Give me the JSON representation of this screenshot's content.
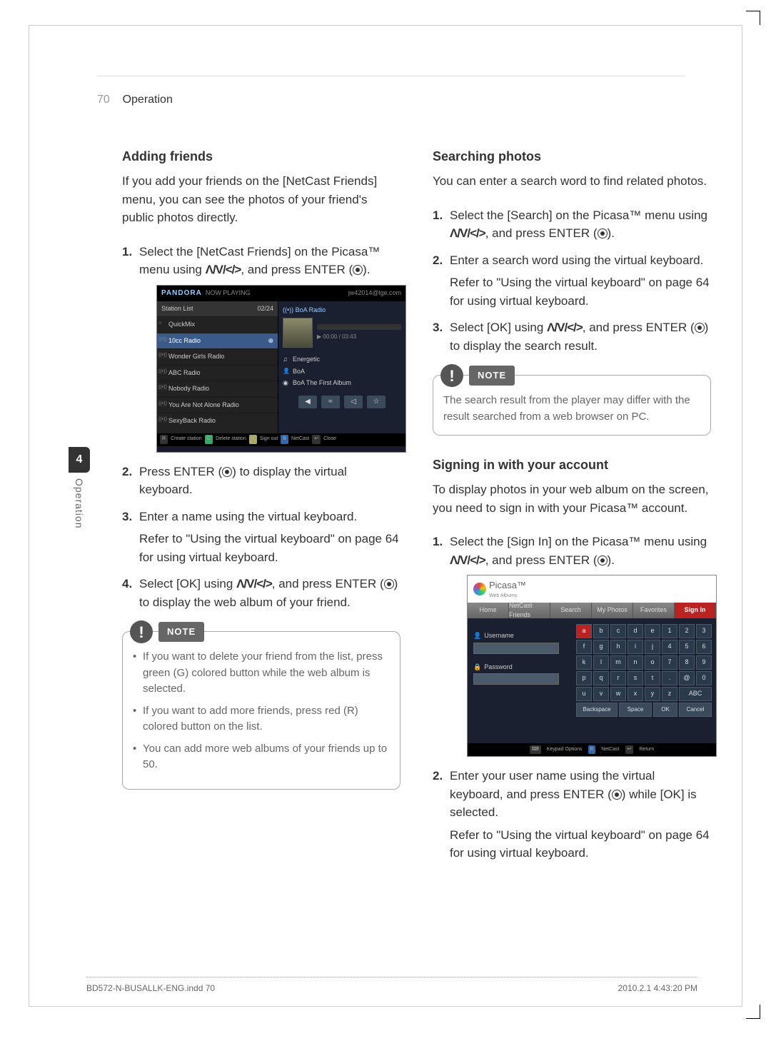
{
  "page_number": "70",
  "section_name": "Operation",
  "side_tab": {
    "number": "4",
    "label": "Operation"
  },
  "left": {
    "h_adding": "Adding friends",
    "adding_intro": "If you add your friends on the [NetCast Friends] menu, you can see the photos of your friend's public photos directly.",
    "adding_steps": [
      {
        "pre": "Select the [NetCast Friends] on the Picasa™ menu using ",
        "nav": "Λ/V/</>",
        "post": ", and press ENTER (",
        "end": ")."
      },
      {
        "pre": "Press ENTER (",
        "post": ") to display the virtual keyboard."
      },
      {
        "pre": "Enter a name using the virtual keyboard.",
        "refer": "Refer to \"Using the virtual keyboard\" on page 64 for using virtual keyboard."
      },
      {
        "pre": "Select [OK] using ",
        "nav": "Λ/V/</>",
        "post": ", and press ENTER (",
        "end": ") to display the web album of your friend."
      }
    ],
    "note_label": "NOTE",
    "note_items": [
      "If you want to delete your friend from the list, press green (G) colored button while the web album is selected.",
      "If you want to add more friends, press red (R) colored button on the list.",
      "You can add more web albums of your friends up to 50."
    ],
    "pandora": {
      "logo": "PANDORA",
      "now_playing": "NOW PLAYING",
      "user": "jw42014@lge.com",
      "station_list_label": "Station List",
      "station_count": "02/24",
      "stations": [
        "QuickMix",
        "10cc Radio",
        "Wonder Girls Radio",
        "ABC Radio",
        "Nobody Radio",
        "You Are Not Alone Radio",
        "SexyBack Radio"
      ],
      "np_station": "BoA Radio",
      "np_time": "00:00 / 03:43",
      "np_track": "Energetic",
      "np_artist": "BoA",
      "np_album": "BoA The First Album",
      "controls": [
        "◀",
        "≈",
        "◁",
        "☆"
      ],
      "bottom": [
        "Create station",
        "Delete station",
        "Sign out",
        "NetCast",
        "Close"
      ]
    }
  },
  "right": {
    "h_searching": "Searching photos",
    "searching_intro": "You can enter a search word to find related photos.",
    "searching_steps": [
      {
        "pre": "Select the [Search] on the Picasa™ menu using ",
        "nav": "Λ/V/</>",
        "post": ", and press ENTER (",
        "end": ")."
      },
      {
        "pre": "Enter a search word using the virtual keyboard.",
        "refer": "Refer to \"Using the virtual keyboard\" on page 64 for using virtual keyboard."
      },
      {
        "pre": "Select [OK] using ",
        "nav": "Λ/V/</>",
        "post": ", and press ENTER (",
        "end": ") to display the search result."
      }
    ],
    "note_label": "NOTE",
    "note_text": "The search result from the player may differ with the result searched from a web browser on PC.",
    "h_signing": "Signing in with your account",
    "signing_intro": "To display photos in your web album on the screen, you need to sign in with your Picasa™ account.",
    "signing_steps": [
      {
        "pre": "Select the [Sign In] on the Picasa™ menu using ",
        "nav": "Λ/V/</>",
        "post": ", and press ENTER (",
        "end": ")."
      },
      {
        "pre": "Enter your user name using the virtual keyboard, and press ENTER (",
        "post": ") while [OK] is selected.",
        "refer": "Refer to \"Using the virtual keyboard\" on page 64 for using virtual keyboard."
      }
    ],
    "picasa": {
      "name": "Picasa™",
      "sub": "Web Albums",
      "tabs": [
        "Home",
        "NetCast Friends",
        "Search",
        "My Photos",
        "Favorites",
        "Sign In"
      ],
      "username_label": "Username",
      "password_label": "Password",
      "keys_r1": [
        "a",
        "b",
        "c",
        "d",
        "e",
        "1",
        "2",
        "3"
      ],
      "keys_r2": [
        "f",
        "g",
        "h",
        "i",
        "j",
        "4",
        "5",
        "6"
      ],
      "keys_r3": [
        "k",
        "l",
        "m",
        "n",
        "o",
        "7",
        "8",
        "9"
      ],
      "keys_r4": [
        "p",
        "q",
        "r",
        "s",
        "t",
        ".",
        "@",
        "0"
      ],
      "keys_r5": [
        "u",
        "v",
        "w",
        "x",
        "y",
        "z",
        "",
        "ABC"
      ],
      "bottom_keys": [
        "Backspace",
        "Space",
        "OK",
        "Cancel"
      ],
      "footer": [
        "Keypad Options",
        "NetCast",
        "Return"
      ]
    }
  },
  "footer": {
    "file": "BD572-N-BUSALLK-ENG.indd   70",
    "timestamp": "2010.2.1   4:43:20 PM"
  }
}
